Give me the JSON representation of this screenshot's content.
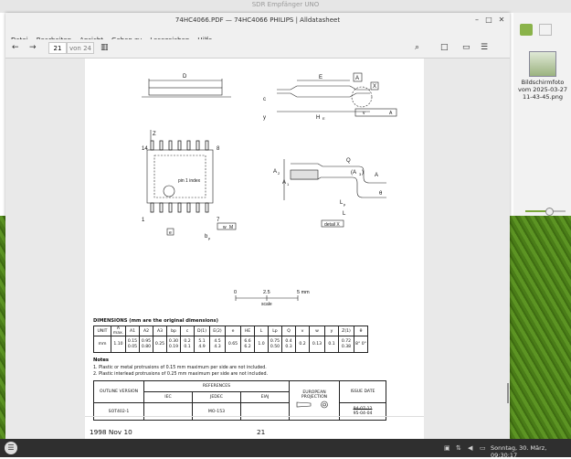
{
  "desktop": {
    "top_title": "SDR Empfänger UNO",
    "file_label": "Bildschirmfoto vom 2025-03-27 11-43-45.png",
    "volume_level": 0.6
  },
  "window": {
    "title": "74HC4066.PDF — 74HC4066 PHILIPS | Alldatasheet",
    "menu": [
      "Datei",
      "Bearbeiten",
      "Ansicht",
      "Gehen zu",
      "Lesezeichen",
      "Hilfe"
    ],
    "page_current": "21",
    "page_total": "von 24"
  },
  "doc": {
    "drawing_labels": {
      "d": "D",
      "e": "E",
      "he": "H",
      "he_sub": "E",
      "c": "c",
      "y": "y",
      "v": "v",
      "a": "A",
      "x": "X",
      "z": "Z",
      "pin14": "14",
      "pin8": "8",
      "pin1": "1",
      "pin7": "7",
      "pin1_index": "pin 1 index",
      "e_box": "e",
      "bp": "b",
      "bp_sub": "p",
      "w": "w",
      "m": "M",
      "q": "Q",
      "a2": "A",
      "a2_sub": "2",
      "a1": "A",
      "a1_sub": "1",
      "a3": "(A",
      "a3_sub": "3",
      "a3_close": ")",
      "a_right": "A",
      "theta": "θ",
      "lp": "L",
      "lp_sub": "p",
      "l": "L",
      "detail": "detail X"
    },
    "scale": {
      "t0": "0",
      "t1": "2.5",
      "t2": "5 mm",
      "label": "scale"
    },
    "dims_title": "DIMENSIONS (mm are the original dimensions)",
    "dims_header": [
      "UNIT",
      "A max.",
      "A1",
      "A2",
      "A3",
      "bp",
      "c",
      "D(1)",
      "E(2)",
      "e",
      "HE",
      "L",
      "Lp",
      "Q",
      "v",
      "w",
      "y",
      "Z(1)",
      "θ"
    ],
    "dims_row": [
      "mm",
      "1.10",
      "0.15 0.05",
      "0.95 0.80",
      "0.25",
      "0.30 0.19",
      "0.2 0.1",
      "5.1 4.9",
      "4.5 4.3",
      "0.65",
      "6.6 6.2",
      "1.0",
      "0.75 0.50",
      "0.4 0.3",
      "0.2",
      "0.13",
      "0.1",
      "0.72 0.38",
      "8° 0°"
    ],
    "notes_title": "Notes",
    "notes": [
      "1. Plastic or metal protrusions of 0.15 mm maximum per side are not included.",
      "2. Plastic interlead protrusions of 0.25 mm maximum per side are not included."
    ],
    "outline": {
      "h_outline": "OUTLINE VERSION",
      "h_refs": "REFERENCES",
      "h_iec": "IEC",
      "h_jedec": "JEDEC",
      "h_eiaj": "EIAJ",
      "h_proj": "EUROPEAN PROJECTION",
      "h_issue": "ISSUE DATE",
      "version": "SOT402-1",
      "iec": "",
      "jedec": "MO-153",
      "eiaj": "",
      "issue_old": "94-07-12",
      "issue_new": "95-04-04"
    },
    "footer_date": "1998 Nov 10",
    "footer_page": "21"
  },
  "taskbar": {
    "clock": "Sonntag, 30. März, 09:30:17"
  }
}
